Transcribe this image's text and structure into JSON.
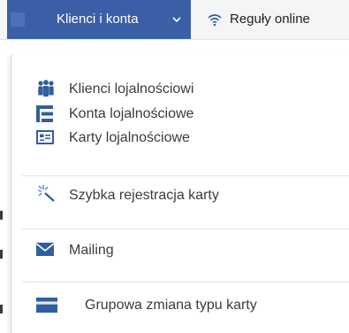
{
  "nav": {
    "tabs": [
      {
        "label": "Klienci i konta",
        "icon": "users-grid-icon",
        "active": true
      },
      {
        "label": "Reguły online",
        "icon": "wifi-icon",
        "active": false
      }
    ]
  },
  "menu": {
    "items": [
      {
        "label": "Klienci lojalnościowi",
        "icon": "users-group-icon"
      },
      {
        "label": "Konta lojalnościowe",
        "icon": "account-tree-icon"
      },
      {
        "label": "Karty lojalnościowe",
        "icon": "id-card-icon"
      },
      {
        "label": "Szybka rejestracja karty",
        "icon": "magic-wand-icon"
      },
      {
        "label": "Mailing",
        "icon": "envelope-icon"
      },
      {
        "label": "Grupowa zmiana typu karty",
        "icon": "credit-card-icon"
      }
    ]
  },
  "colors": {
    "active_tab": "#3a5fa6",
    "menu_icon": "#2f5f9e",
    "separator": "#e2e2e2"
  }
}
